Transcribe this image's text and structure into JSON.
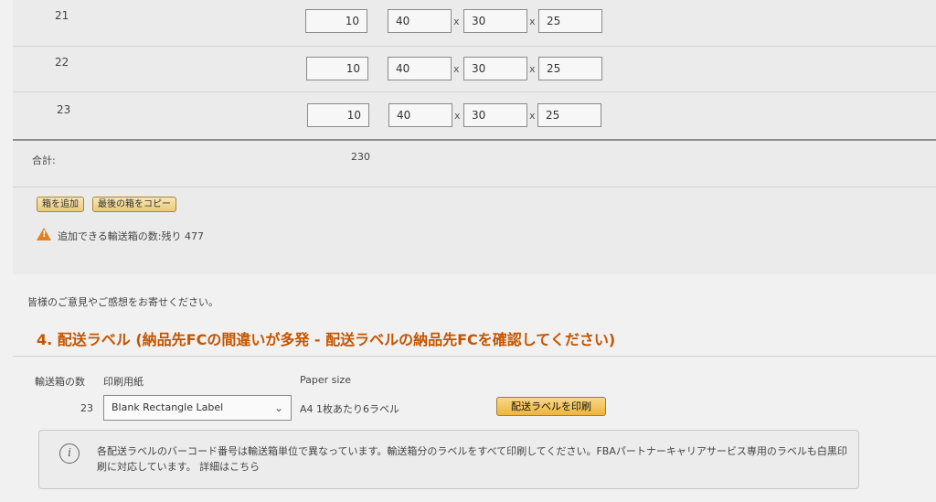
{
  "boxes": [
    {
      "num": "21",
      "qty": "10",
      "l": "40",
      "w": "30",
      "h": "25"
    },
    {
      "num": "22",
      "qty": "10",
      "l": "40",
      "w": "30",
      "h": "25"
    },
    {
      "num": "23",
      "qty": "10",
      "l": "40",
      "w": "30",
      "h": "25"
    }
  ],
  "times": "x",
  "total_label": "合計:",
  "total_value": "230",
  "buttons": {
    "add_box": "箱を追加",
    "copy_last": "最後の箱をコピー"
  },
  "warning": "追加できる輸送箱の数:残り 477",
  "feedback": "皆様のご意見やご感想をお寄せください。",
  "section_title": "4. 配送ラベル (納品先FCの間違いが多発 - 配送ラベルの納品先FCを確認してください)",
  "label_cols": {
    "box_count": "輸送箱の数",
    "paper": "印刷用紙",
    "paper_size": "Paper size"
  },
  "label_row": {
    "count": "23",
    "select": "Blank Rectangle Label",
    "size": "A4 1枚あたり6ラベル",
    "print": "配送ラベルを印刷"
  },
  "info": "各配送ラベルのバーコード番号は輸送箱単位で異なっています。輸送箱分のラベルをすべて印刷してください。FBAパートナーキャリアサービス専用のラベルも白黒印刷に対応しています。 詳細はこちら",
  "colors": {
    "accent": "#c45500",
    "button": "#efb43d",
    "warning": "#e67e22"
  }
}
